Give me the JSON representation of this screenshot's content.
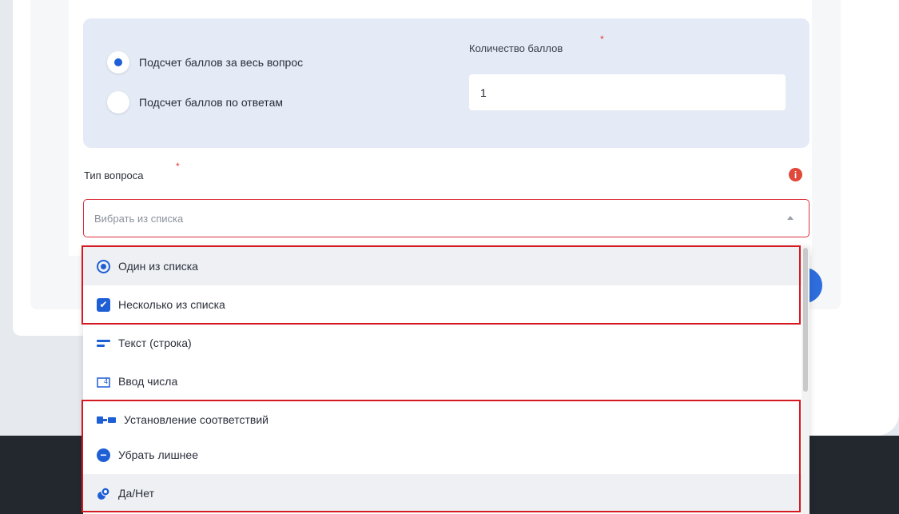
{
  "scoring": {
    "option_whole": "Подсчет баллов за весь вопрос",
    "option_answers": "Подсчет баллов по ответам",
    "points_label": "Количество баллов",
    "required_mark": "*",
    "points_value": "1"
  },
  "question_type": {
    "label": "Тип вопроса",
    "required_mark": "*",
    "info_icon": "i",
    "placeholder": "Вибрать из списка",
    "options": [
      {
        "label": "Один из списка",
        "icon": "radio-icon"
      },
      {
        "label": "Несколько из списка",
        "icon": "checkbox-icon",
        "glyph": "✔"
      },
      {
        "label": "Текст (строка)",
        "icon": "text-line-icon"
      },
      {
        "label": "Ввод числа",
        "icon": "number-input-icon",
        "glyph": "4"
      },
      {
        "label": "Установление соответствий",
        "icon": "matching-icon"
      },
      {
        "label": "Убрать лишнее",
        "icon": "remove-extra-icon",
        "glyph": "−"
      },
      {
        "label": "Да/Нет",
        "icon": "yes-no-icon"
      }
    ]
  },
  "colors": {
    "accent": "#1f5fd6",
    "panel": "#e4ebf6",
    "error": "#d8303b",
    "highlight": "#d41921"
  }
}
